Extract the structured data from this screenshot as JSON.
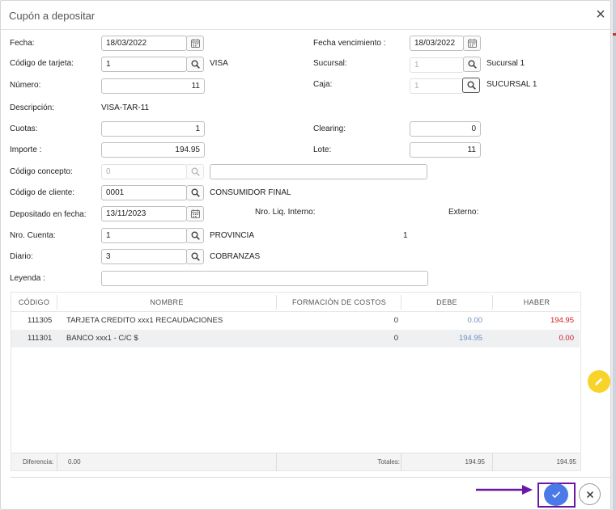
{
  "dialog": {
    "title": "Cupón a depositar",
    "close_icon": "×"
  },
  "form": {
    "fecha": {
      "label": "Fecha:",
      "value": "18/03/2022"
    },
    "fecha_vencimiento": {
      "label": "Fecha vencimiento :",
      "value": "18/03/2022"
    },
    "codigo_tarjeta": {
      "label": "Código de tarjeta:",
      "value": "1",
      "desc": "VISA"
    },
    "sucursal": {
      "label": "Sucursal:",
      "value": "1",
      "desc": "Sucursal 1"
    },
    "numero": {
      "label": "Número:",
      "value": "11"
    },
    "caja": {
      "label": "Caja:",
      "value": "1",
      "desc": "SUCURSAL 1"
    },
    "descripcion": {
      "label": "Descripción:",
      "value": "VISA-TAR-11"
    },
    "cuotas": {
      "label": "Cuotas:",
      "value": "1"
    },
    "clearing": {
      "label": "Clearing:",
      "value": "0"
    },
    "importe": {
      "label": "Importe :",
      "value": "194.95"
    },
    "lote": {
      "label": "Lote:",
      "value": "11"
    },
    "codigo_concepto": {
      "label": "Código concepto:",
      "value": "0",
      "desc": ""
    },
    "codigo_cliente": {
      "label": "Código de cliente:",
      "value": "0001",
      "desc": "CONSUMIDOR FINAL"
    },
    "depositado_fecha": {
      "label": "Depositado en fecha:",
      "value": "13/11/2023"
    },
    "nro_liq_interno": {
      "label": "Nro. Liq. Interno:"
    },
    "externo": {
      "label": "Externo:"
    },
    "nro_cuenta": {
      "label": "Nro. Cuenta:",
      "value": "1",
      "desc": "PROVINCIA",
      "extra": "1"
    },
    "diario": {
      "label": "Diario:",
      "value": "3",
      "desc": "COBRANZAS"
    },
    "leyenda": {
      "label": "Leyenda :",
      "value": ""
    }
  },
  "grid": {
    "columns": [
      "CÓDIGO",
      "NOMBRE",
      "FORMACIÓN DE COSTOS",
      "DEBE",
      "HABER"
    ],
    "rows": [
      {
        "codigo": "111305",
        "nombre": "TARJETA CREDITO xxx1 RECAUDACIONES",
        "formacion": "0",
        "debe": "0.00",
        "haber": "194.95"
      },
      {
        "codigo": "111301",
        "nombre": "BANCO xxx1 - C/C $",
        "formacion": "0",
        "debe": "194.95",
        "haber": "0.00"
      }
    ],
    "footer": {
      "diferencia_label": "Diferencia:",
      "diferencia_value": "0.00",
      "totales_label": "Totales:",
      "total_debe": "194.95",
      "total_haber": "194.95"
    }
  },
  "icons": {
    "calendar": "calendar-icon",
    "search": "search-icon",
    "edit": "pencil-icon",
    "confirm": "check-icon",
    "cancel": "close-icon",
    "arrow": "arrow-right-icon"
  },
  "colors": {
    "confirm_button": "#4a7ae8",
    "edit_fab": "#f8d32a",
    "highlight_box": "#6a17a8",
    "debe_blue": "#6a8fc0",
    "haber_red": "#d01e1e"
  }
}
